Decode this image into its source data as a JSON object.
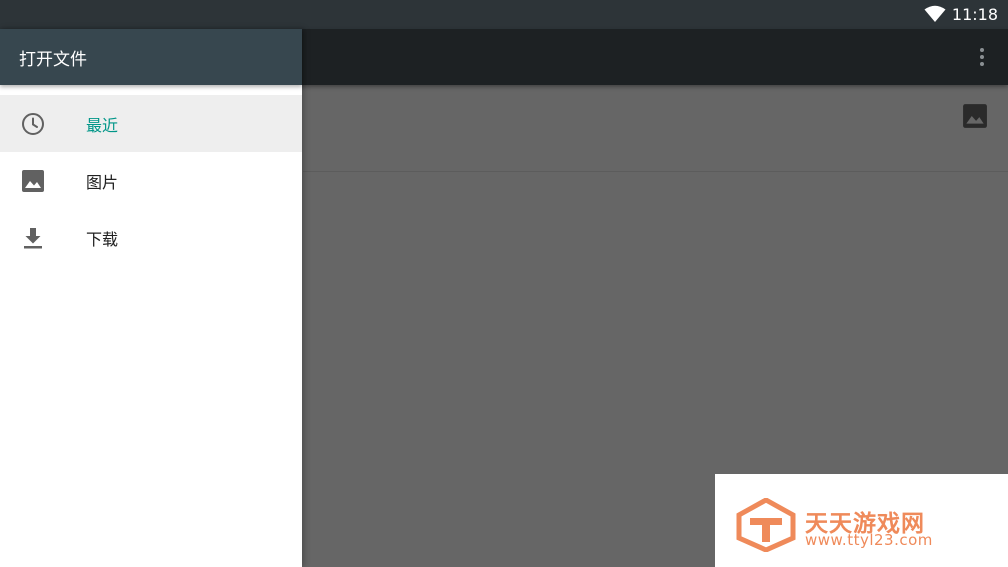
{
  "status_bar": {
    "time": "11:18",
    "wifi_icon": "wifi-icon"
  },
  "drawer": {
    "title": "打开文件",
    "items": [
      {
        "label": "最近",
        "icon": "clock-icon",
        "selected": true
      },
      {
        "label": "图片",
        "icon": "image-icon",
        "selected": false
      },
      {
        "label": "下载",
        "icon": "download-icon",
        "selected": false
      }
    ]
  },
  "toolbar": {
    "overflow_icon": "more-vert-icon",
    "view_toggle_icon": "image-icon"
  },
  "watermark": {
    "title": "天天游戏网",
    "url": "www.ttyl23.com"
  },
  "colors": {
    "status_bar": "#2d3438",
    "drawer_header": "#37474f",
    "accent": "#009688",
    "scrim": "#666666",
    "watermark": "#ef8a5a"
  }
}
